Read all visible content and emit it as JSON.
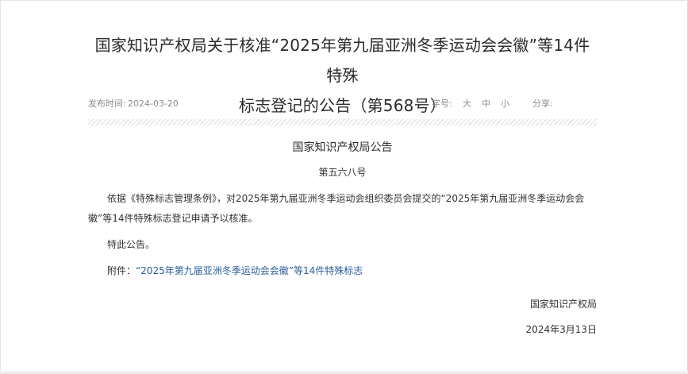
{
  "article": {
    "title_line1": "国家知识产权局关于核准“2025年第九届亚洲冬季运动会会徽”等14件特殊",
    "title_line2": "标志登记的公告（第568号）"
  },
  "meta": {
    "publish_label": "发布时间:",
    "publish_date": "2024-03-20",
    "font_size_label": "字号:",
    "font_sizes": [
      "大",
      "中",
      "小"
    ],
    "share_label": "分享:"
  },
  "body": {
    "heading": "国家知识产权局公告",
    "number": "第五六八号",
    "paragraph": "依据《特殊标志管理条例》，对2025年第九届亚洲冬季运动会组织委员会提交的“2025年第九届亚洲冬季运动会会徽”等14件特殊标志登记申请予以核准。",
    "notice": "特此公告。",
    "attachment_label": "附件：",
    "attachment_link": "“2025年第九届亚洲冬季运动会会徽”等14件特殊标志",
    "signature": "国家知识产权局",
    "sign_date": "2024年3月13日"
  },
  "colors": {
    "link": "#2a5d98",
    "text": "#333333",
    "meta": "#8c8c8c"
  }
}
